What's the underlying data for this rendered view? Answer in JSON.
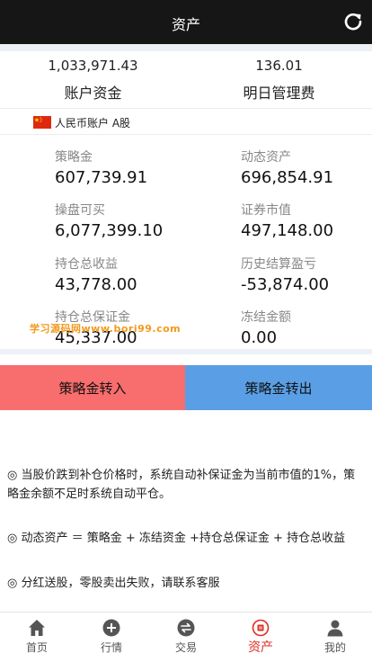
{
  "header": {
    "title": "资产"
  },
  "summary": {
    "account_funds": {
      "value": "1,033,971.43",
      "label": "账户资金"
    },
    "next_day_fee": {
      "value": "136.01",
      "label": "明日管理费"
    }
  },
  "account": {
    "label": "人民币账户 A股"
  },
  "metrics": [
    {
      "label": "策略金",
      "value": "607,739.91"
    },
    {
      "label": "动态资产",
      "value": "696,854.91"
    },
    {
      "label": "操盘可买",
      "value": "6,077,399.10"
    },
    {
      "label": "证券市值",
      "value": "497,148.00"
    },
    {
      "label": "持仓总收益",
      "value": "43,778.00"
    },
    {
      "label": "历史结算盈亏",
      "value": "-53,874.00"
    },
    {
      "label": "持仓总保证金",
      "value": "45,337.00"
    },
    {
      "label": "冻结金额",
      "value": "0.00"
    }
  ],
  "watermark": "学习源码网www.bori99.com",
  "buttons": {
    "transfer_in": "策略金转入",
    "transfer_out": "策略金转出"
  },
  "notes": [
    "◎ 当股价跌到补仓价格时，系统自动补保证金为当前市值的1%，策略金余额不足时系统自动平仓。",
    "◎ 动态资产 ＝ 策略金 + 冻结资金 +持仓总保证金 + 持仓总收益",
    "◎ 分红送股，零股卖出失败，请联系客服"
  ],
  "tabbar": [
    {
      "label": "首页",
      "icon": "home-icon"
    },
    {
      "label": "行情",
      "icon": "plus-circle-icon"
    },
    {
      "label": "交易",
      "icon": "exchange-icon"
    },
    {
      "label": "资产",
      "icon": "wallet-icon",
      "active": true
    },
    {
      "label": "我的",
      "icon": "user-icon"
    }
  ],
  "colors": {
    "header_bg": "#161616",
    "transfer_in_bg": "#f86d6d",
    "transfer_out_bg": "#5a9fe5",
    "active_tab": "#e02e24",
    "watermark": "#f29a1d"
  }
}
